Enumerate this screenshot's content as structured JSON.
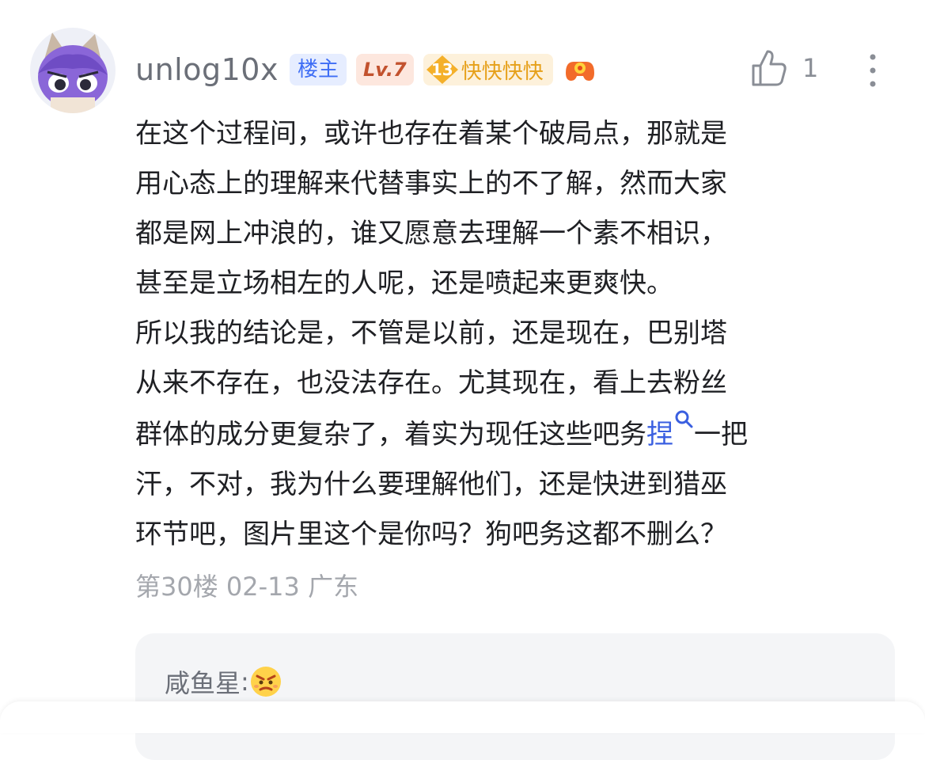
{
  "comment": {
    "username": "unlog10x",
    "owner_tag": "楼主",
    "level_tag": "Lv.7",
    "fan_level": "13",
    "fan_name": "快快快快",
    "like_count": "1",
    "icons": {
      "avatar": "cartoon-cat-avatar",
      "badge": "game-controller-badge-icon",
      "like": "thumb-up-icon",
      "more": "more-vertical-icon",
      "search": "search-mark-icon"
    },
    "lines": [
      "在这个过程间，或许也存在着某个破局点，那就是",
      "用心态上的理解来代替事实上的不了解，然而大家",
      "都是网上冲浪的，谁又愿意去理解一个素不相识，",
      "甚至是立场相左的人呢，还是喷起来更爽快。",
      "所以我的结论是，不管是以前，还是现在，巴别塔",
      "从来不存在，也没法存在。尤其现在，看上去粉丝"
    ],
    "line7_before": "群体的成分更复杂了，着实为现任这些吧务",
    "line7_link": "捏",
    "line7_after": "一把",
    "lines_tail": [
      "汗，不对，我为什么要理解他们，还是快进到猎巫",
      "环节吧，图片里这个是你吗？狗吧务这都不删么？"
    ],
    "floor": "第30楼",
    "date": "02-13",
    "location": "广东"
  },
  "reply_preview": {
    "author": "咸鱼星",
    "emoji": "angry-face-emoji"
  },
  "colors": {
    "text": "#1f2024",
    "meta": "#a4a7ad",
    "link": "#3a5fe0",
    "owner_tag_bg": "#e6edff",
    "level_tag_bg": "#fde7de",
    "fan_tag_bg": "#fdf1db"
  }
}
